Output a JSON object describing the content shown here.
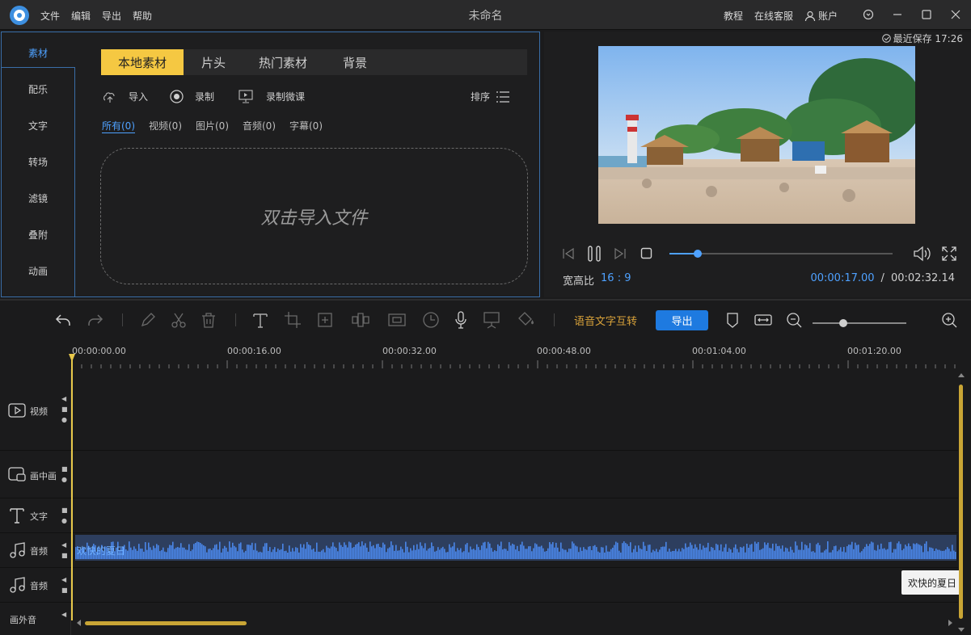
{
  "app": {
    "title": "未命名",
    "menu": [
      "文件",
      "编辑",
      "导出",
      "帮助"
    ],
    "right_menu": [
      "教程",
      "在线客服",
      "账户"
    ],
    "saved": "最近保存 17:26"
  },
  "left_tabs": [
    "素材",
    "配乐",
    "文字",
    "转场",
    "滤镜",
    "叠附",
    "动画"
  ],
  "sub_tabs": [
    "本地素材",
    "片头",
    "热门素材",
    "背景"
  ],
  "actions": {
    "import": "导入",
    "record": "录制",
    "record_lesson": "录制微课",
    "sort": "排序"
  },
  "filters": [
    "所有(0)",
    "视频(0)",
    "图片(0)",
    "音频(0)",
    "字幕(0)"
  ],
  "dropzone": "双击导入文件",
  "preview": {
    "ratio_label": "宽高比",
    "ratio_value": "16 : 9",
    "current_time": "00:00:17.00",
    "separator": "/",
    "total_time": "00:02:32.14",
    "progress": 0.127
  },
  "toolbar": {
    "speech_convert": "语音文字互转",
    "export": "导出",
    "zoom_level": 0.33
  },
  "timeline": {
    "ruler": [
      "00:00:00.00",
      "00:00:16.00",
      "00:00:32.00",
      "00:00:48.00",
      "00:01:04.00",
      "00:01:20.00"
    ],
    "tracks": [
      {
        "name": "视频"
      },
      {
        "name": "画中画"
      },
      {
        "name": "文字"
      },
      {
        "name": "音频"
      },
      {
        "name": "音频"
      },
      {
        "name": "画外音"
      }
    ],
    "audio_clip": "欢快的夏日",
    "tooltip": "欢快的夏日"
  },
  "colors": {
    "accent": "#4ea1ff",
    "tab_active": "#f5c842",
    "export_button": "#1e7ae0",
    "speech_text": "#d8a23a",
    "waveform": "#4a86e8",
    "playhead": "#e8c84a"
  }
}
